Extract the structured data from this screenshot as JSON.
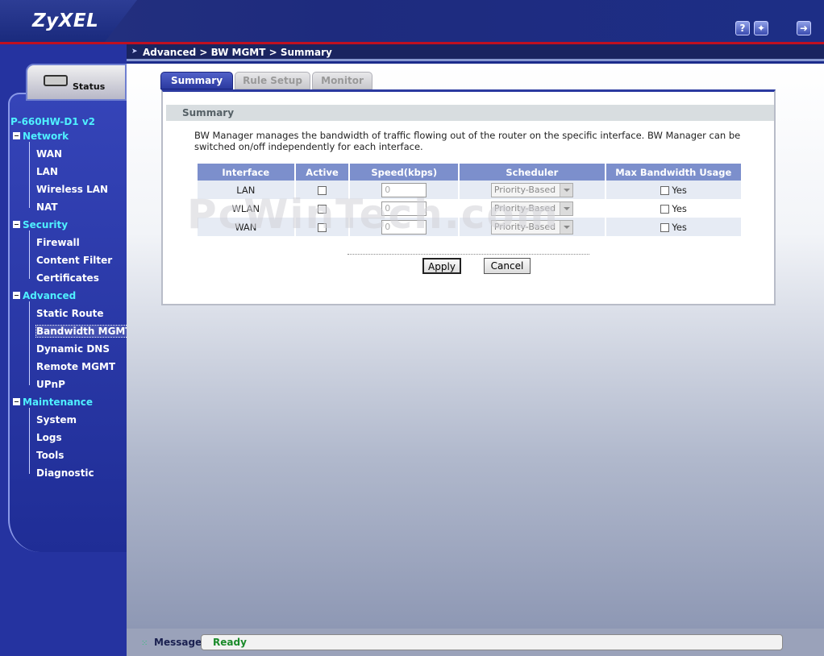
{
  "header": {
    "logo": "ZyXEL",
    "help_icon": "help-icon",
    "wizard_icon": "wizard-icon",
    "logout_icon": "logout-icon"
  },
  "breadcrumb": "Advanced > BW MGMT > Summary",
  "sidebar": {
    "status_label": "Status",
    "model": "P-660HW-D1 v2",
    "sections": [
      {
        "label": "Network",
        "items": [
          "WAN",
          "LAN",
          "Wireless LAN",
          "NAT"
        ]
      },
      {
        "label": "Security",
        "items": [
          "Firewall",
          "Content Filter",
          "Certificates"
        ]
      },
      {
        "label": "Advanced",
        "items": [
          "Static Route",
          "Bandwidth MGMT",
          "Dynamic DNS",
          "Remote MGMT",
          "UPnP"
        ]
      },
      {
        "label": "Maintenance",
        "items": [
          "System",
          "Logs",
          "Tools",
          "Diagnostic"
        ]
      }
    ],
    "active_item": "Bandwidth MGMT"
  },
  "tabs": [
    {
      "label": "Summary",
      "active": true
    },
    {
      "label": "Rule Setup",
      "active": false
    },
    {
      "label": "Monitor",
      "active": false
    }
  ],
  "summary": {
    "title": "Summary",
    "description": "BW Manager manages the bandwidth of traffic flowing out of the router on the specific interface. BW Manager can be switched on/off independently for each interface.",
    "columns": [
      "Interface",
      "Active",
      "Speed(kbps)",
      "Scheduler",
      "Max Bandwidth Usage"
    ],
    "rows": [
      {
        "interface": "LAN",
        "active": false,
        "speed": "0",
        "scheduler": "Priority-Based",
        "max_bw": false,
        "max_bw_label": "Yes"
      },
      {
        "interface": "WLAN",
        "active": false,
        "speed": "0",
        "scheduler": "Priority-Based",
        "max_bw": false,
        "max_bw_label": "Yes"
      },
      {
        "interface": "WAN",
        "active": false,
        "speed": "0",
        "scheduler": "Priority-Based",
        "max_bw": false,
        "max_bw_label": "Yes"
      }
    ],
    "apply_label": "Apply",
    "cancel_label": "Cancel"
  },
  "watermark": "PcWinTech.com",
  "statusbar": {
    "label": "Message",
    "message": "Ready"
  }
}
